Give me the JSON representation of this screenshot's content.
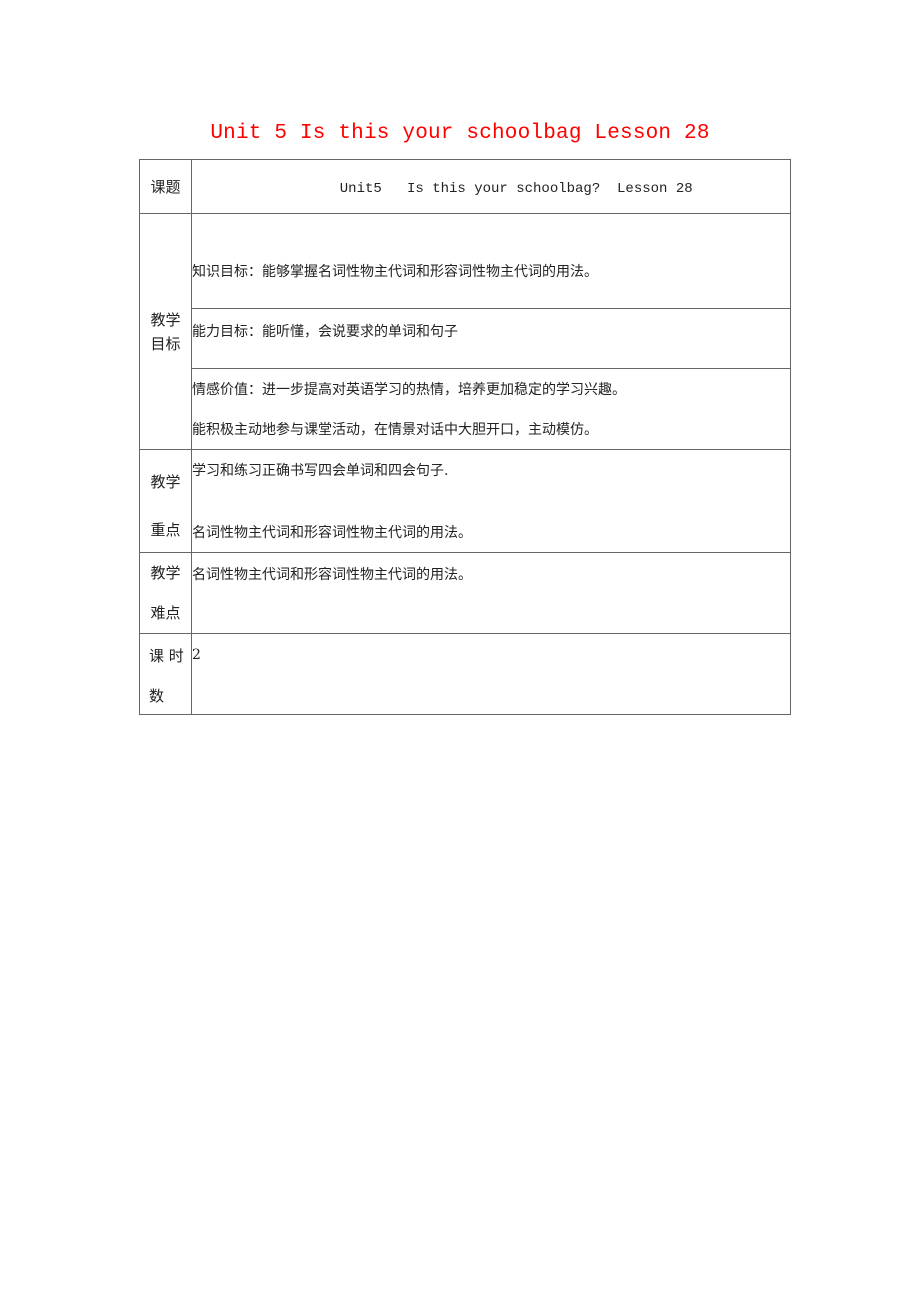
{
  "document": {
    "title": "Unit 5 Is this your schoolbag Lesson 28",
    "title_color": "#ff0000"
  },
  "table": {
    "topic": {
      "label": "课题",
      "value": "Unit5   Is this your schoolbag?  Lesson 28"
    },
    "objectives": {
      "label_line1": "教学",
      "label_line2": "目标",
      "knowledge": "知识目标：能够掌握名词性物主代词和形容词性物主代词的用法。",
      "ability": "能力目标：能听懂，会说要求的单词和句子",
      "emotion_line1": "情感价值：进一步提高对英语学习的热情，培养更加稳定的学习兴趣。",
      "emotion_line2": "能积极主动地参与课堂活动，在情景对话中大胆开口，主动模仿。"
    },
    "key_points": {
      "label_line1": "教学",
      "label_line2": "重点",
      "line1": "学习和练习正确书写四会单词和四会句子.",
      "line2": "名词性物主代词和形容词性物主代词的用法。"
    },
    "difficulties": {
      "label_line1": "教学",
      "label_line2": "难点",
      "line1": "名词性物主代词和形容词性物主代词的用法。"
    },
    "periods": {
      "label_line1": "课 时",
      "label_line2": "数",
      "value": "2"
    }
  }
}
